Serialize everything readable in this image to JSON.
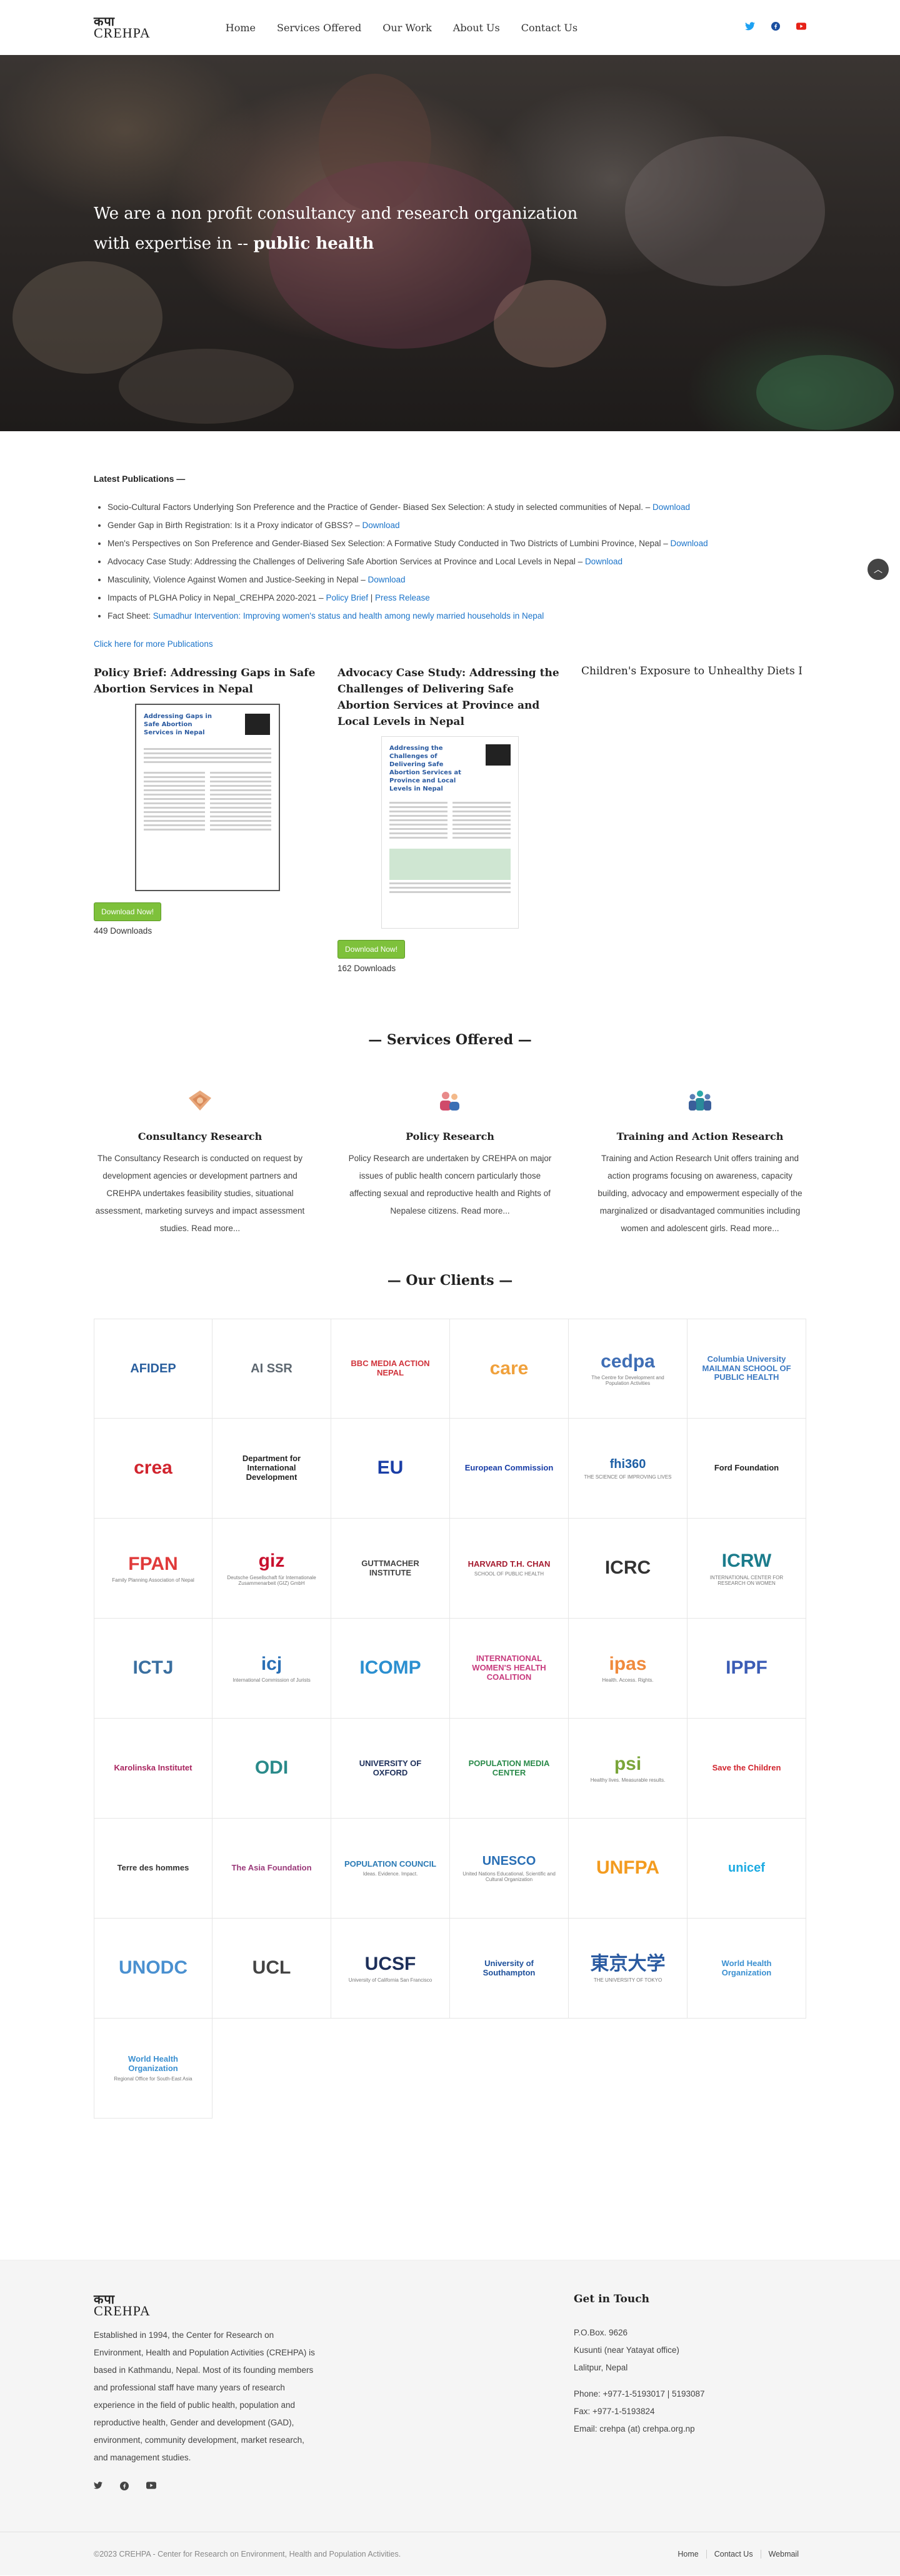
{
  "header": {
    "logo_dev": "कपा",
    "logo_lat": "CREHPA",
    "nav": [
      "Home",
      "Services Offered",
      "Our Work",
      "About Us",
      "Contact Us"
    ],
    "social_icons": [
      "twitter-icon",
      "facebook-icon",
      "youtube-icon"
    ]
  },
  "hero": {
    "line1": "We are a non profit consultancy and research organization",
    "line2_prefix": "with expertise in -- ",
    "line2_bold": "public health"
  },
  "publications": {
    "heading": "Latest Publications —",
    "items": [
      {
        "text": "Socio-Cultural Factors Underlying Son Preference and the Practice of Gender- Biased Sex Selection: A study in selected communities of Nepal. – ",
        "link": "Download"
      },
      {
        "text": "Gender Gap in Birth Registration: Is it a Proxy indicator of GBSS? – ",
        "link": "Download"
      },
      {
        "text": "Men's Perspectives on Son Preference and Gender-Biased Sex Selection: A Formative Study Conducted in Two Districts of Lumbini Province, Nepal – ",
        "link": "Download"
      },
      {
        "text": "Advocacy Case Study: Addressing the Challenges of Delivering Safe Abortion Services at Province and Local Levels in Nepal – ",
        "link": "Download"
      },
      {
        "text": "Masculinity, Violence Against Women and Justice-Seeking in Nepal – ",
        "link": "Download"
      },
      {
        "text": "Impacts of PLGHA Policy in Nepal_CREHPA 2020-2021 – ",
        "link": "Policy Brief",
        "sep": " | ",
        "link2": "Press Release"
      },
      {
        "text": "Fact Sheet: ",
        "link": "Sumadhur Intervention: Improving women's status and health among newly married households in Nepal"
      }
    ],
    "more": "Click here for more Publications"
  },
  "cards": [
    {
      "title": "Policy Brief: Addressing Gaps in Safe Abortion Services in Nepal",
      "thumb_title": "Addressing Gaps in Safe Abortion Services in Nepal",
      "button": "Download Now!",
      "downloads": "449 Downloads"
    },
    {
      "title": "Advocacy Case Study: Addressing the Challenges of Delivering Safe Abortion Services at Province and Local Levels in Nepal",
      "thumb_title": "Addressing the Challenges of Delivering Safe Abortion Services at Province and Local Levels in Nepal",
      "button": "Download Now!",
      "downloads": "162 Downloads"
    },
    {
      "title": "Children's Exposure to Unhealthy Diets I"
    }
  ],
  "services": {
    "heading": "— Services Offered —",
    "items": [
      {
        "title": "Consultancy Research",
        "text": "The Consultancy Research is conducted on request by development agencies or development partners and CREHPA undertakes feasibility studies, situational assessment, marketing surveys and impact assessment studies. ",
        "more": "Read more..."
      },
      {
        "title": "Policy Research",
        "text": "Policy Research are undertaken by CREHPA on major issues of public health concern particularly those affecting sexual and reproductive health and Rights of Nepalese citizens. ",
        "more": "Read more..."
      },
      {
        "title": "Training and Action Research",
        "text": "Training and Action Research Unit offers training and action programs focusing on awareness, capacity building, advocacy and empowerment especially of the marginalized or disadvantaged communities including women and adolescent girls. ",
        "more": "Read more..."
      }
    ]
  },
  "clients": {
    "heading": "— Our Clients —",
    "logos": [
      {
        "name": "AFIDEP",
        "color": "#2a5f9e"
      },
      {
        "name": "AI SSR",
        "color": "#5d6770"
      },
      {
        "name": "BBC MEDIA ACTION NEPAL",
        "color": "#d0343c"
      },
      {
        "name": "care",
        "color": "#f0a13c"
      },
      {
        "name": "cedpa",
        "sub": "The Centre for Development and Population Activities",
        "color": "#3f6eb5"
      },
      {
        "name": "Columbia University MAILMAN SCHOOL OF PUBLIC HEALTH",
        "color": "#3b79c2"
      },
      {
        "name": "crea",
        "color": "#d1242e"
      },
      {
        "name": "Department for International Development",
        "color": "#222222"
      },
      {
        "name": "EU",
        "color": "#1a3ea6"
      },
      {
        "name": "European Commission",
        "color": "#1a3ea6"
      },
      {
        "name": "fhi360",
        "sub": "THE SCIENCE OF IMPROVING LIVES",
        "color": "#1d5fa5"
      },
      {
        "name": "Ford Foundation",
        "color": "#222222"
      },
      {
        "name": "FPAN",
        "sub": "Family Planning Association of Nepal",
        "color": "#e03a3a"
      },
      {
        "name": "giz",
        "sub": "Deutsche Gesellschaft für Internationale Zusammenarbeit (GIZ) GmbH",
        "color": "#c8102e"
      },
      {
        "name": "GUTTMACHER INSTITUTE",
        "color": "#444444"
      },
      {
        "name": "HARVARD T.H. CHAN",
        "sub": "SCHOOL OF PUBLIC HEALTH",
        "color": "#a51c30"
      },
      {
        "name": "ICRC",
        "color": "#333333"
      },
      {
        "name": "ICRW",
        "sub": "INTERNATIONAL CENTER FOR RESEARCH ON WOMEN",
        "color": "#1c7c8c"
      },
      {
        "name": "ICTJ",
        "color": "#3a6fa0"
      },
      {
        "name": "icj",
        "sub": "International Commission of Jurists",
        "color": "#2a6fb5"
      },
      {
        "name": "ICOMP",
        "color": "#2b8fd0"
      },
      {
        "name": "INTERNATIONAL WOMEN'S HEALTH COALITION",
        "color": "#c73a7d"
      },
      {
        "name": "ipas",
        "sub": "Health. Access. Rights.",
        "color": "#f08a3c"
      },
      {
        "name": "IPPF",
        "color": "#3a5bb5"
      },
      {
        "name": "Karolinska Institutet",
        "color": "#a8255f"
      },
      {
        "name": "ODI",
        "color": "#2a8a8a"
      },
      {
        "name": "UNIVERSITY OF OXFORD",
        "color": "#1d2f5a"
      },
      {
        "name": "POPULATION MEDIA CENTER",
        "color": "#2a8a4a"
      },
      {
        "name": "psi",
        "sub": "Healthy lives. Measurable results.",
        "color": "#7aa53a"
      },
      {
        "name": "Save the Children",
        "color": "#d1242e"
      },
      {
        "name": "Terre des hommes",
        "color": "#333333"
      },
      {
        "name": "The Asia Foundation",
        "color": "#9a3a7a"
      },
      {
        "name": "POPULATION COUNCIL",
        "sub": "Ideas. Evidence. Impact.",
        "color": "#2a7ab5"
      },
      {
        "name": "UNESCO",
        "sub": "United Nations Educational, Scientific and Cultural Organization",
        "color": "#2a6fb5"
      },
      {
        "name": "UNFPA",
        "color": "#f39b1f"
      },
      {
        "name": "unicef",
        "color": "#1cabe2"
      },
      {
        "name": "UNODC",
        "color": "#4a90d0"
      },
      {
        "name": "UCL",
        "color": "#444444"
      },
      {
        "name": "UCSF",
        "sub": "University of California San Francisco",
        "color": "#1d2f5a"
      },
      {
        "name": "University of Southampton",
        "color": "#1d4f9a"
      },
      {
        "name": "東京大学",
        "sub": "THE UNIVERSITY OF TOKYO",
        "color": "#2a5aa0"
      },
      {
        "name": "World Health Organization",
        "color": "#3a8fd0"
      },
      {
        "name": "World Health Organization",
        "sub": "Regional Office for South-East Asia",
        "color": "#3a8fd0"
      }
    ]
  },
  "footer": {
    "about": "Established in 1994, the Center for Research on Environment, Health and Population Activities (CREHPA) is based in Kathmandu, Nepal. Most of its founding members and professional staff have many years of research experience in the field of public health, population and reproductive health, Gender and development (GAD), environment, community development, market research, and management studies.",
    "contact_heading": "Get in Touch",
    "address": [
      "P.O.Box. 9626",
      "Kusunti (near Yatayat office)",
      "Lalitpur, Nepal"
    ],
    "phone": "Phone: +977-1-5193017 | 5193087",
    "fax": "Fax: +977-1-5193824",
    "email": "Email: crehpa (at) crehpa.org.np",
    "copyright": "©2023 CREHPA - Center for Research on Environment, Health and Population Activities.",
    "links": [
      "Home",
      "Contact Us",
      "Webmail"
    ]
  }
}
